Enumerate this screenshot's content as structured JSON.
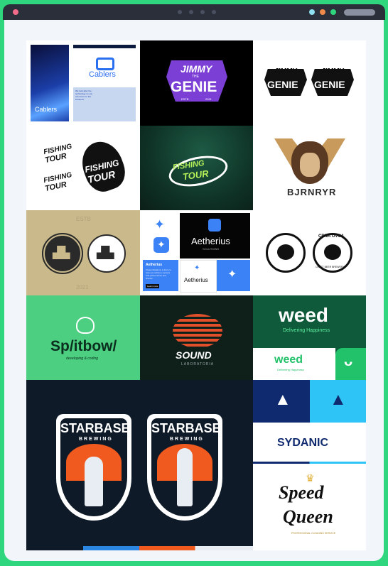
{
  "window": {
    "traffic_lights": [
      "#f36b8b",
      "#8ee0f0",
      "#f08a4b",
      "#2fd67e"
    ],
    "progress_dots": 4
  },
  "tiles": {
    "cablers": {
      "brand": "Cablers",
      "note": "We look after the technology so you can focus on the business."
    },
    "jimmy_genie_1": {
      "top": "JIMMY",
      "the": "THE",
      "main": "GENIE",
      "left_year": "ESTB",
      "right_year": "2021"
    },
    "jimmy_genie_2": {
      "top": "JIMMY",
      "the": "THE",
      "main": "GENIE",
      "left_year": "ESTB",
      "right_year": "2021"
    },
    "fishing_tour_bw": {
      "line1": "FISHING",
      "line2": "TOUR"
    },
    "fishing_tour_neon": {
      "line1": "FISHING",
      "line2": "TOUR"
    },
    "bjornar": {
      "name": "BJRNRYR"
    },
    "hard_industry": {
      "badge": "HARD INDUSTRY",
      "sub": "BREWING COMPANY",
      "estb": "ESTB",
      "year": "2021"
    },
    "aetherius": {
      "name": "Aetherius",
      "sub": "SOLUTIONS",
      "card_title": "Aetherius",
      "card_text": "Chaos Relations is there to help you achieve success with performance and finance.",
      "button": "Learn more"
    },
    "crna_ovca": {
      "top": "CRNA OVCA",
      "bottom": "CRAFT BEER BREWERY"
    },
    "splitbowl": {
      "name": "Sp/itbow/",
      "tag": "developing & coding"
    },
    "sound_lab": {
      "name": "SOUND",
      "sub": "LABORATORIA"
    },
    "weed": {
      "name": "weed",
      "tagline": "Delivering Happiness"
    },
    "starbase": {
      "name": "STARBASE",
      "sub": "BREWING"
    },
    "sydanic": {
      "name": "SYDANIC"
    },
    "speed_queen": {
      "line1": "Speed",
      "line2": "Queen",
      "sub": "PROFESSIONAL CLEANING SERVICE"
    }
  }
}
